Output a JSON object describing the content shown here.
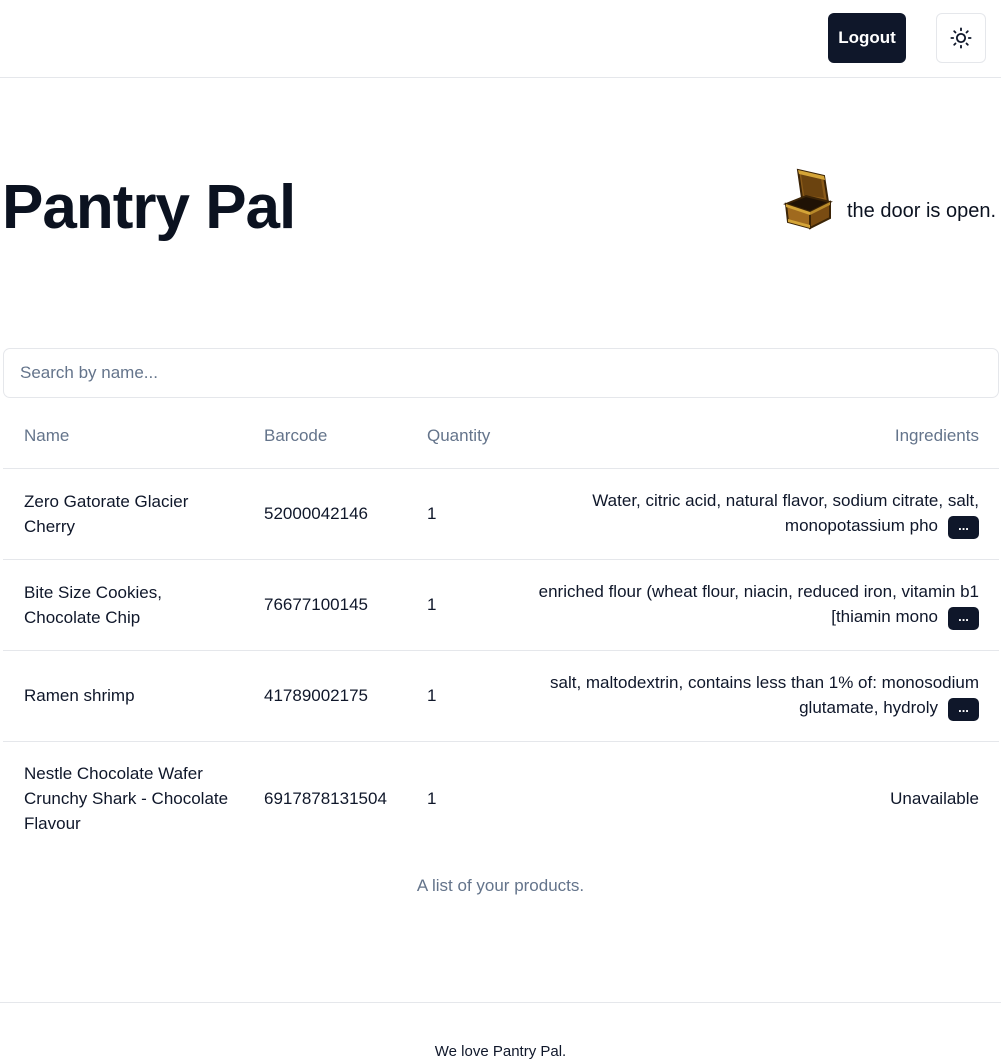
{
  "header": {
    "logout_label": "Logout",
    "theme_icon": "sun-icon"
  },
  "app": {
    "title": "Pantry Pal",
    "door_icon": "open-chest-icon",
    "door_status": "the door is open."
  },
  "search": {
    "placeholder": "Search by name...",
    "value": ""
  },
  "table": {
    "columns": [
      "Name",
      "Barcode",
      "Quantity",
      "Ingredients"
    ],
    "rows": [
      {
        "name": "Zero Gatorate Glacier Cherry",
        "barcode": "52000042146",
        "quantity": "1",
        "ingredients": "Water, citric acid, natural flavor, sodium citrate, salt, monopotassium pho",
        "more_label": "..."
      },
      {
        "name": "Bite Size Cookies, Chocolate Chip",
        "barcode": "76677100145",
        "quantity": "1",
        "ingredients": "enriched flour (wheat flour, niacin, reduced iron, vitamin b1 [thiamin mono",
        "more_label": "..."
      },
      {
        "name": "Ramen shrimp",
        "barcode": "41789002175",
        "quantity": "1",
        "ingredients": "salt, maltodextrin, contains less than 1% of: monosodium glutamate, hydroly",
        "more_label": "..."
      },
      {
        "name": "Nestle Chocolate Wafer Crunchy Shark - Chocolate Flavour",
        "barcode": "6917878131504",
        "quantity": "1",
        "ingredients": "Unavailable"
      }
    ],
    "caption": "A list of your products."
  },
  "footer": {
    "text": "We love Pantry Pal."
  },
  "colors": {
    "primary": "#0f172a",
    "muted": "#64748b",
    "border": "#e5e7eb",
    "chest_wood": "#8a5a19",
    "chest_gold": "#d4a437"
  }
}
